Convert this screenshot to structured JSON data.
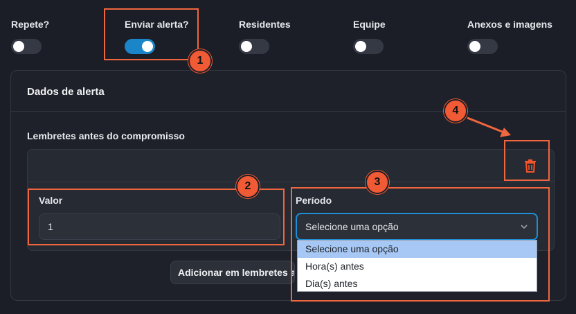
{
  "toggles": [
    {
      "label": "Repete?",
      "on": false
    },
    {
      "label": "Enviar alerta?",
      "on": true
    },
    {
      "label": "Residentes",
      "on": false
    },
    {
      "label": "Equipe",
      "on": false
    },
    {
      "label": "Anexos e imagens",
      "on": false
    }
  ],
  "card": {
    "title": "Dados de alerta",
    "reminders_label": "Lembretes antes do compromisso",
    "value_label": "Valor",
    "value": "1",
    "period_label": "Período",
    "period_selected": "Selecione uma opção",
    "period_options": [
      "Selecione uma opção",
      "Hora(s) antes",
      "Dia(s) antes"
    ],
    "add_button": "Adicionar em lembretes antes do compromisso",
    "delete_icon": "trash-icon"
  },
  "annotations": {
    "badges": [
      "1",
      "2",
      "3",
      "4"
    ],
    "color": "#f0663f"
  }
}
